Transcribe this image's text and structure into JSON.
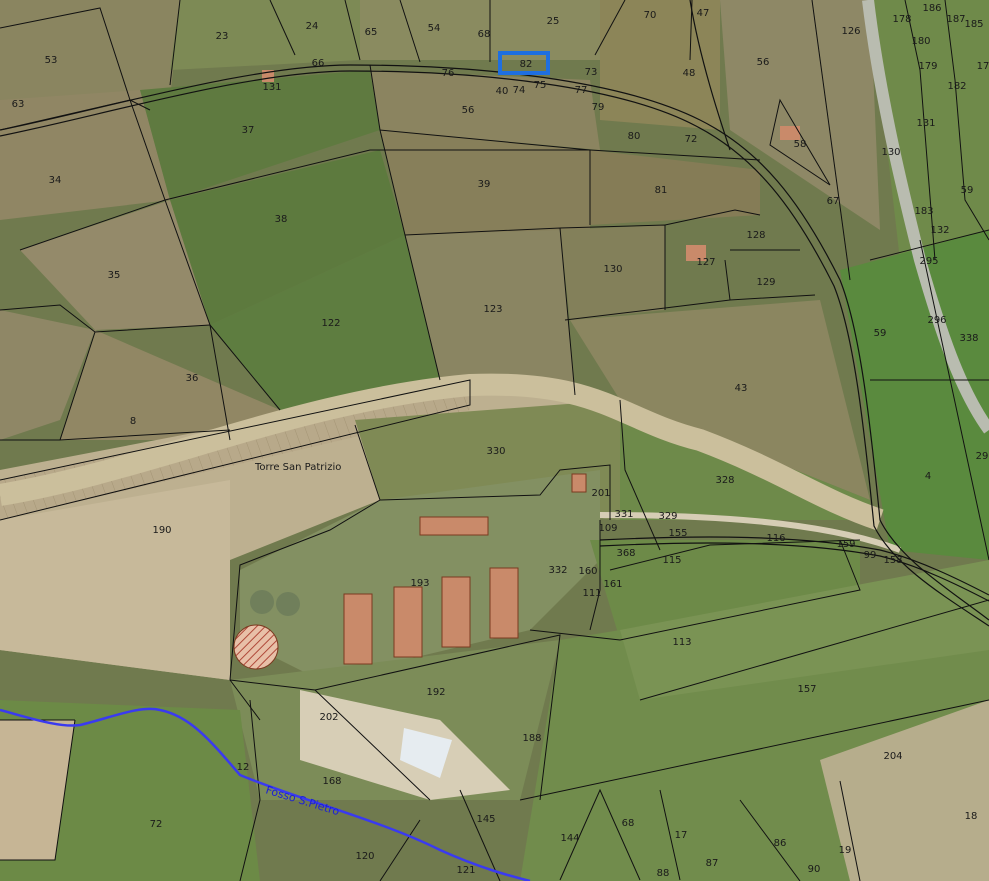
{
  "map": {
    "place_name": "Torre San Patrizio",
    "watercourse_name": "Fosso S.Pietro",
    "selected_parcel": "82",
    "colors": {
      "parcel_border": "#111111",
      "selected_parcel": "#1e6fe0",
      "watercourse": "#3a3af0",
      "building_fill": "#c98a6a",
      "building_hatch": "#b04a3a"
    },
    "parcels": [
      "23",
      "24",
      "65",
      "54",
      "68",
      "25",
      "70",
      "47",
      "56",
      "126",
      "178",
      "186",
      "187",
      "185",
      "53",
      "66",
      "131",
      "76",
      "82",
      "73",
      "48",
      "180",
      "179",
      "182",
      "17",
      "63",
      "40",
      "74",
      "75",
      "77",
      "79",
      "56",
      "58",
      "37",
      "80",
      "72",
      "131",
      "130",
      "34",
      "39",
      "81",
      "67",
      "183",
      "59",
      "38",
      "128",
      "132",
      "127",
      "295",
      "35",
      "130",
      "129",
      "122",
      "123",
      "296",
      "59",
      "338",
      "36",
      "43",
      "8",
      "330",
      "4",
      "29",
      "328",
      "201",
      "190",
      "331",
      "329",
      "109",
      "155",
      "116",
      "159",
      "99",
      "158",
      "368",
      "115",
      "332",
      "160",
      "161",
      "111",
      "193",
      "113",
      "157",
      "192",
      "202",
      "188",
      "204",
      "12",
      "168",
      "72",
      "145",
      "68",
      "17",
      "144",
      "86",
      "18",
      "120",
      "121",
      "88",
      "87",
      "90",
      "19"
    ]
  }
}
